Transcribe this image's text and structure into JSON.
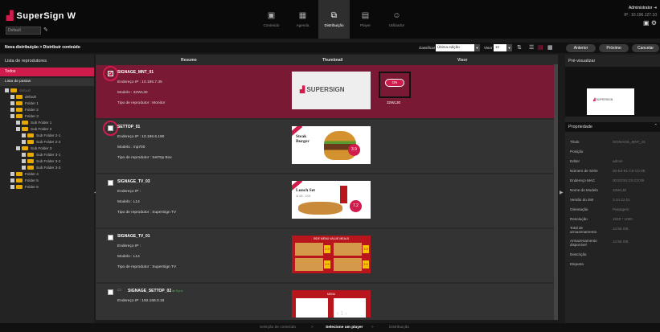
{
  "app": {
    "logo": "SuperSign W",
    "site": "Default"
  },
  "nav": [
    {
      "label": "Conteúdo",
      "icon": "content-icon",
      "glyph": "▣",
      "active": false
    },
    {
      "label": "Agenda",
      "icon": "calendar-icon",
      "glyph": "▦",
      "active": false
    },
    {
      "label": "Distribuição",
      "icon": "distribution-icon",
      "glyph": "⧉",
      "active": true
    },
    {
      "label": "Player",
      "icon": "player-icon",
      "glyph": "▤",
      "active": false
    },
    {
      "label": "Utilizador",
      "icon": "user-icon",
      "glyph": "☺",
      "active": false
    }
  ],
  "user": {
    "name": "Administrator",
    "ip": "IP : 10.196.127.10"
  },
  "toolbar": {
    "breadcrumb": "Nova distribuição > Distribuir conteúdo",
    "sort_label": "classificar",
    "sort_value": "Última edição",
    "view_label": "Visor",
    "view_value": "10",
    "prev": "Anterior",
    "next": "Próximo",
    "cancel": "Cancelar"
  },
  "left": {
    "title": "Lista de reprodutores",
    "all": "Todos",
    "folder_list": "Lista de pastas",
    "tree": [
      {
        "label": "default",
        "level": 1,
        "selected": true
      },
      {
        "label": "default",
        "level": 2
      },
      {
        "label": "Folder 1",
        "level": 2
      },
      {
        "label": "Folder 2",
        "level": 2
      },
      {
        "label": "Folder 3",
        "level": 2
      },
      {
        "label": "Sub Folder 1",
        "level": 3
      },
      {
        "label": "Sub Folder 2",
        "level": 3
      },
      {
        "label": "Sub Folder 2-1",
        "level": 4
      },
      {
        "label": "Sub Folder 2-2",
        "level": 4
      },
      {
        "label": "Sub Folder 3",
        "level": 3
      },
      {
        "label": "Sub Folder 3-1",
        "level": 4
      },
      {
        "label": "Sub Folder 3-2",
        "level": 4
      },
      {
        "label": "Sub Folder 3-3",
        "level": 4
      },
      {
        "label": "Folder 4",
        "level": 2
      },
      {
        "label": "Folder 5",
        "level": 2
      },
      {
        "label": "Folder 6",
        "level": 2
      }
    ]
  },
  "table": {
    "headers": {
      "summary": "Resumo",
      "thumbnail": "Thumbnail",
      "display": "Visor"
    },
    "rows": [
      {
        "name": "SIGNAGE_MNT_01",
        "checked": true,
        "selected": true,
        "l1": "Endereço IP : 10.196.7.35",
        "l2": "Modelo : 32WL30",
        "l3": "Tipo de reprodutor : Monitor",
        "thumb": "supersign",
        "monitor_label": "32WL30",
        "on_label": "ON"
      },
      {
        "name": "SETTOP_01",
        "checked": false,
        "selected": false,
        "l1": "Endereço IP : 10.196.6.190",
        "l2": "Modelo : mp700",
        "l3": "Tipo de reprodutor : SetTop Box",
        "thumb": "burger",
        "thumb_title": "Steak Burger",
        "price": "3.9"
      },
      {
        "name": "SIGNAGE_TV_03",
        "checked": false,
        "selected": false,
        "l1": "Endereço IP :",
        "l2": "Modelo : L14",
        "l3": "Tipo de reprodutor : SuperSign TV",
        "thumb": "lunch",
        "thumb_title": "Lunch Set",
        "thumb_time": "11:00 - 2:00",
        "price": "7.2"
      },
      {
        "name": "SIGNAGE_TV_01",
        "checked": false,
        "selected": false,
        "l1": "Endereço IP :",
        "l2": "Modelo : L14",
        "l3": "Tipo de reprodutor : SuperSign TV",
        "thumb": "menu",
        "thumb_title": "SIDE MENU VALUE MEALS",
        "prices": [
          "4.5",
          "3.8",
          "4.5",
          "3.5"
        ]
      },
      {
        "name": "SIGNAGE_SETTOP_02",
        "checked": false,
        "selected": false,
        "sync": "Sync",
        "l1": "Endereço IP : 192.168.0.18",
        "l2": "",
        "l3": "",
        "thumb": "menu2",
        "thumb_title": "MENU"
      }
    ],
    "pager": "‹  1  ›"
  },
  "preview": {
    "title": "Pré-visualizar",
    "logo": "SUPERSIGN"
  },
  "properties": {
    "title": "Propriedade",
    "items": [
      {
        "k": "Título",
        "v": "SIGNAGE_MNT_01"
      },
      {
        "k": "Posição",
        "v": ""
      },
      {
        "k": "Editor",
        "v": "admin"
      },
      {
        "k": "Número de Série",
        "v": "00-E0-91-C6-C0-09"
      },
      {
        "k": "Endereço MAC",
        "v": "00:E0:91:C6:C0:09"
      },
      {
        "k": "Nome do Modelo",
        "v": "32WL30"
      },
      {
        "k": "Versão do SW",
        "v": "3.24.12.01"
      },
      {
        "k": "Orientação",
        "v": "Paisagem"
      },
      {
        "k": "Resolução",
        "v": "1920 * 1080"
      },
      {
        "k": "Total de armazenamento",
        "v": "14.56 GB"
      },
      {
        "k": "Armazenamento disponível",
        "v": "14.56 GB"
      },
      {
        "k": "Descrição",
        "v": ""
      },
      {
        "k": "Etiqueta",
        "v": ""
      }
    ]
  },
  "steps": [
    "Seleção de conteúdo",
    ">",
    "Selecione um player",
    ">",
    "Distribuição"
  ],
  "colors": {
    "accent": "#d01c4d",
    "selected_row": "#7a1933"
  }
}
